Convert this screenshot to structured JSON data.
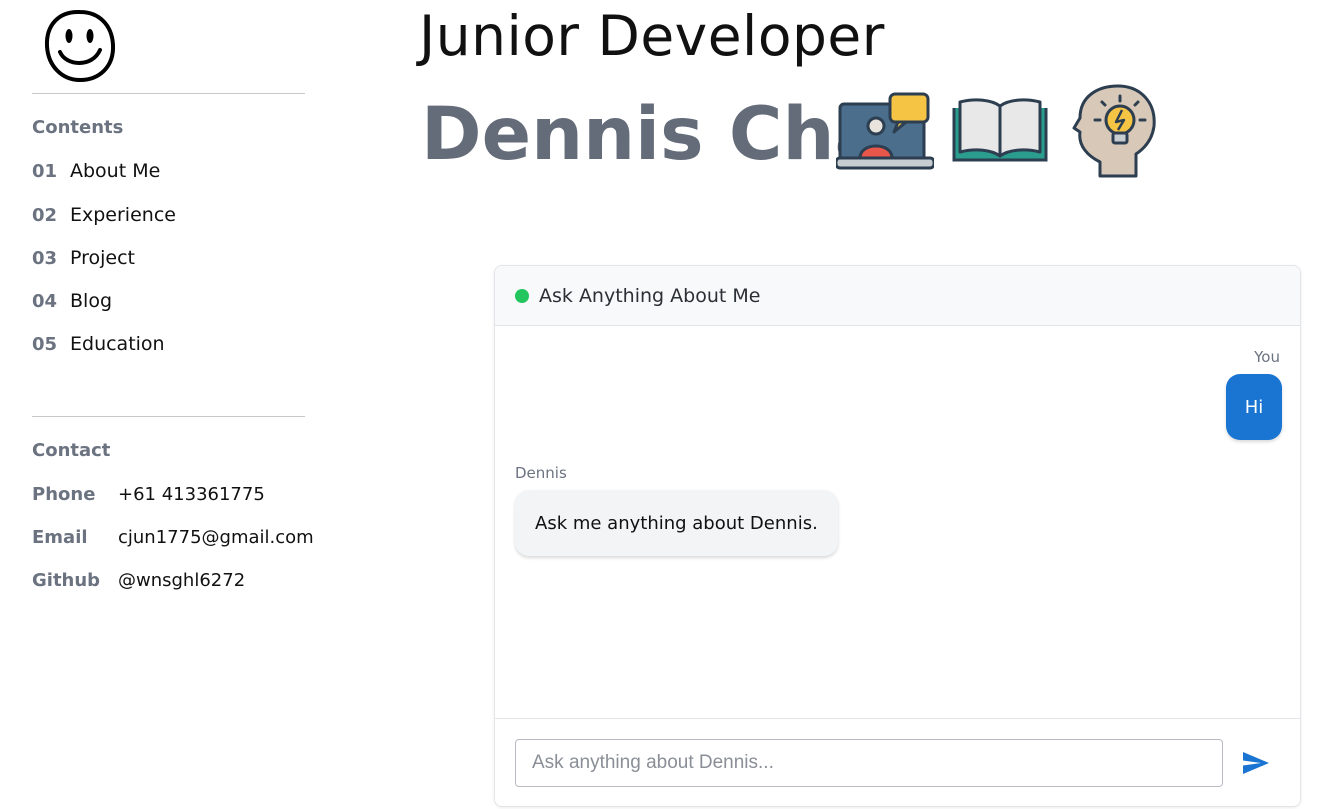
{
  "sidebar": {
    "logo_icon": "smiley-face-icon",
    "contents": {
      "title": "Contents",
      "items": [
        {
          "num": "01",
          "label": "About Me"
        },
        {
          "num": "02",
          "label": "Experience"
        },
        {
          "num": "03",
          "label": "Project"
        },
        {
          "num": "04",
          "label": "Blog"
        },
        {
          "num": "05",
          "label": "Education"
        }
      ]
    },
    "contact": {
      "title": "Contact",
      "phone": {
        "key": "Phone",
        "value": "+61 413361775"
      },
      "email": {
        "key": "Email",
        "value": "cjun1775@gmail.com"
      },
      "github": {
        "key": "Github",
        "value": "@wnsghl6272"
      }
    }
  },
  "header": {
    "role": "Junior Developer",
    "name": "Dennis Cha",
    "icons": [
      "laptop-chat-icon",
      "open-book-icon",
      "head-lightbulb-icon"
    ]
  },
  "chat": {
    "title": "Ask Anything About Me",
    "status_color": "#22c55e",
    "messages": [
      {
        "sender": "You",
        "text": "Hi"
      },
      {
        "sender": "Dennis",
        "text": "Ask me anything about Dennis."
      }
    ],
    "input_placeholder": "Ask anything about Dennis...",
    "send_icon": "send-icon",
    "accent_color": "#1a75d2"
  }
}
